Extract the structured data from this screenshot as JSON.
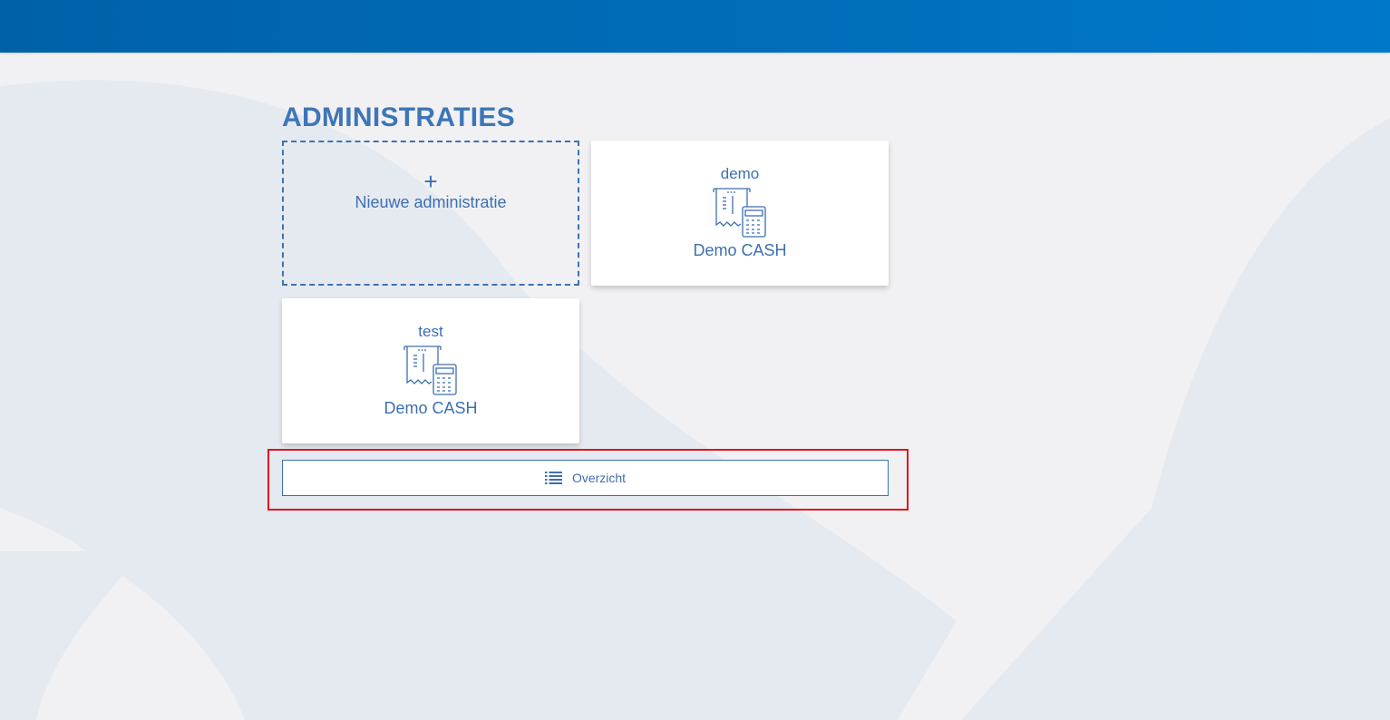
{
  "colors": {
    "topbar": "#006cb8",
    "accent": "#3d6fb0",
    "background": "#f1f1f3",
    "highlight": "#e0141e"
  },
  "page": {
    "title": "ADMINISTRATIES"
  },
  "new_tile": {
    "icon": "plus-icon",
    "plus_glyph": "+",
    "label": "Nieuwe administratie"
  },
  "administrations": [
    {
      "name": "demo",
      "type": "Demo CASH",
      "icon": "cash-register-calculator-icon"
    },
    {
      "name": "test",
      "type": "Demo CASH",
      "icon": "cash-register-calculator-icon"
    }
  ],
  "overview_button": {
    "label": "Overzicht",
    "icon": "list-icon"
  }
}
